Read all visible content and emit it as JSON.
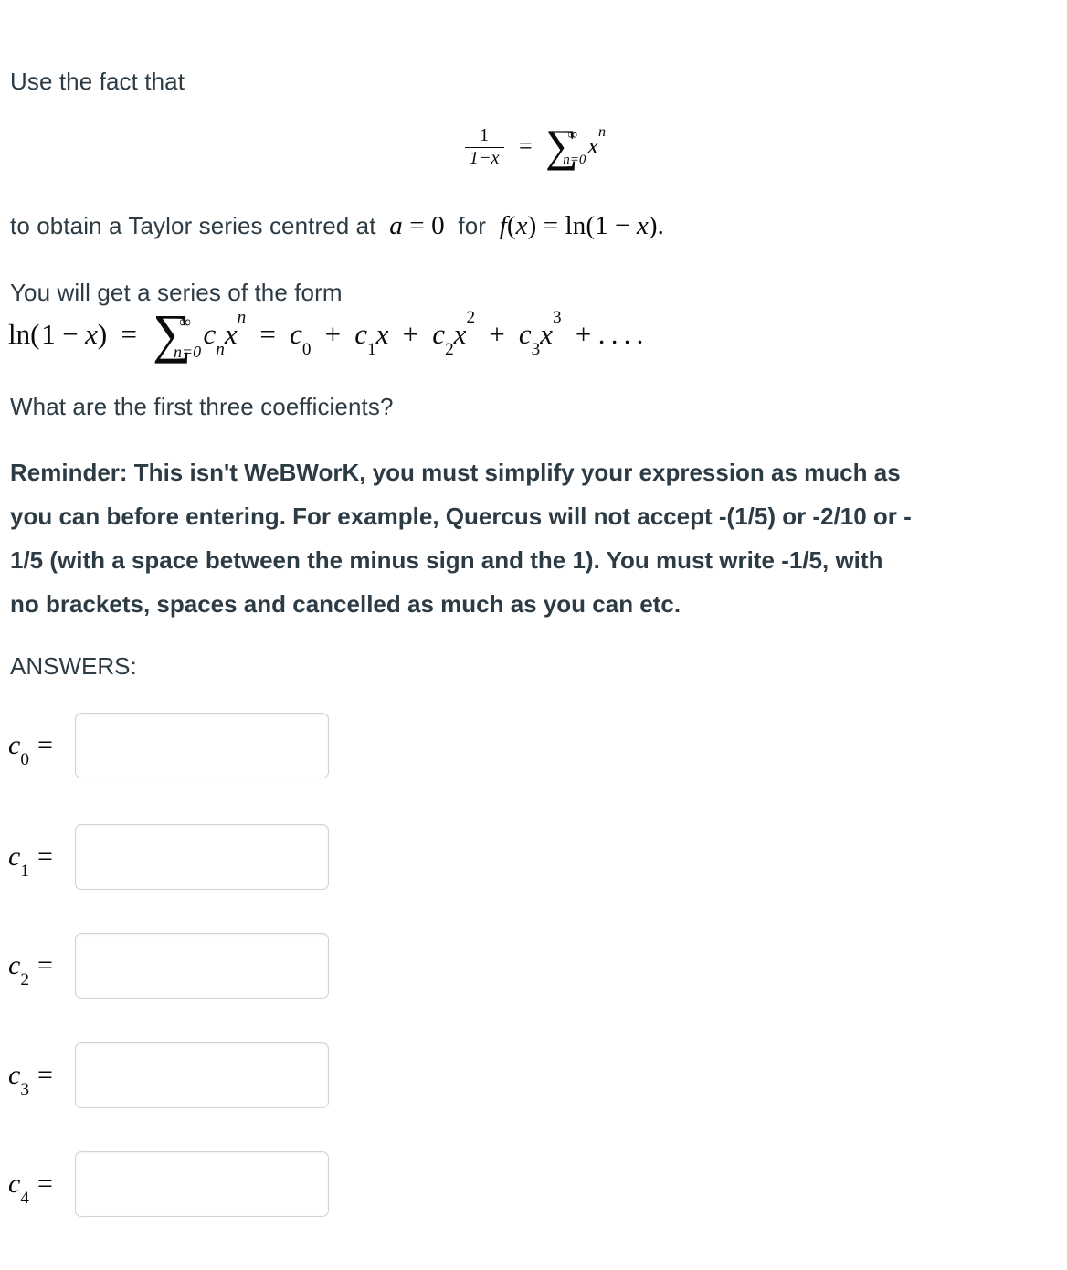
{
  "document": {
    "intro_line": "Use the fact that",
    "display_equation": {
      "lhs_fraction": {
        "numerator": "1",
        "denominator": "1−x"
      },
      "equals": "=",
      "sum": {
        "symbol": "∑",
        "upper_limit": "∞",
        "lower_limit": "n=0"
      },
      "summand": {
        "base": "x",
        "exponent": "n"
      },
      "plain_text": "1/(1−x) = ∑ from n=0 to ∞ of x^n"
    },
    "line_after_equation": {
      "before": "to obtain a Taylor series centred at",
      "math_a": "a = 0",
      "middle": "for",
      "math_f": "f(x) = ln(1 − x).",
      "plain_text": "to obtain a Taylor series centred at a = 0 for f(x) = ln(1 − x)."
    },
    "series_form_label": "You will get a series of the form",
    "series_equation": {
      "lhs": "ln(1 − x)",
      "sum": {
        "symbol": "∑",
        "upper_limit": "∞",
        "lower_limit": "n=0"
      },
      "sum_term": "c_n x^n",
      "expansion": "c₀ + c₁x + c₂x² + c₃x³ + . . . .",
      "plain_text": "ln(1 − x) = ∑_{n=0}^{∞} c_n x^n = c₀ + c₁ x + c₂ x² + c₃ x³ + ...."
    },
    "question": "What are the first three coefficients?",
    "reminder": "Reminder: This isn't WeBWorK, you must simplify your expression as much as you can before entering. For example, Quercus will not accept -(1/5) or -2/10 or -1/5 (with a space between the minus sign and the 1). You must write -1/5, with no brackets, spaces and cancelled as much as you can etc.",
    "reminder_lines": [
      "Reminder: This isn't WeBWorK, you must simplify your expression as much as",
      "you can before entering. For example, Quercus will not accept -(1/5) or -2/10 or -",
      "1/5 (with a space between the minus sign and the 1). You must write -1/5, with",
      "no brackets, spaces and cancelled as much as you can etc."
    ]
  },
  "answers": {
    "heading": "ANSWERS:",
    "equals_sign": "=",
    "fields": [
      {
        "coefficient": "c",
        "subscript": "0",
        "value": "",
        "placeholder": ""
      },
      {
        "coefficient": "c",
        "subscript": "1",
        "value": "",
        "placeholder": ""
      },
      {
        "coefficient": "c",
        "subscript": "2",
        "value": "",
        "placeholder": ""
      },
      {
        "coefficient": "c",
        "subscript": "3",
        "value": "",
        "placeholder": ""
      },
      {
        "coefficient": "c",
        "subscript": "4",
        "value": "",
        "placeholder": ""
      }
    ]
  },
  "colors": {
    "text": "#2d3b45",
    "math": "#0b0b0b",
    "input_border": "#d2d2d2",
    "background": "#ffffff"
  }
}
